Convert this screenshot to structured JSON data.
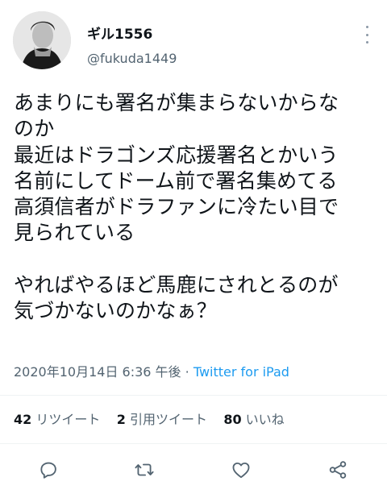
{
  "user": {
    "display_name": "ギル1556",
    "handle": "@fukuda1449"
  },
  "tweet": {
    "text": "あまりにも署名が集まらないからな\nのか\n最近はドラゴンズ応援署名とかいう\n名前にしてドーム前で署名集めてる\n高須信者がドラファンに冷たい目で\n見られている\n\nやればやるほど馬鹿にされとるのが\n気づかないのかなぁ？",
    "timestamp": "2020年10月14日 6:36 午後",
    "separator": " · ",
    "source": "Twitter for iPad"
  },
  "stats": {
    "retweets_count": "42",
    "retweets_label": "リツイート",
    "quotes_count": "2",
    "quotes_label": "引用ツイート",
    "likes_count": "80",
    "likes_label": "いいね"
  },
  "icons": {
    "more": "more-dots-icon",
    "reply": "reply-icon",
    "retweet": "retweet-icon",
    "like": "heart-icon",
    "share": "share-icon"
  },
  "colors": {
    "text": "#0f1419",
    "secondary": "#536471",
    "link": "#1d9bf0",
    "icon": "#536471"
  }
}
